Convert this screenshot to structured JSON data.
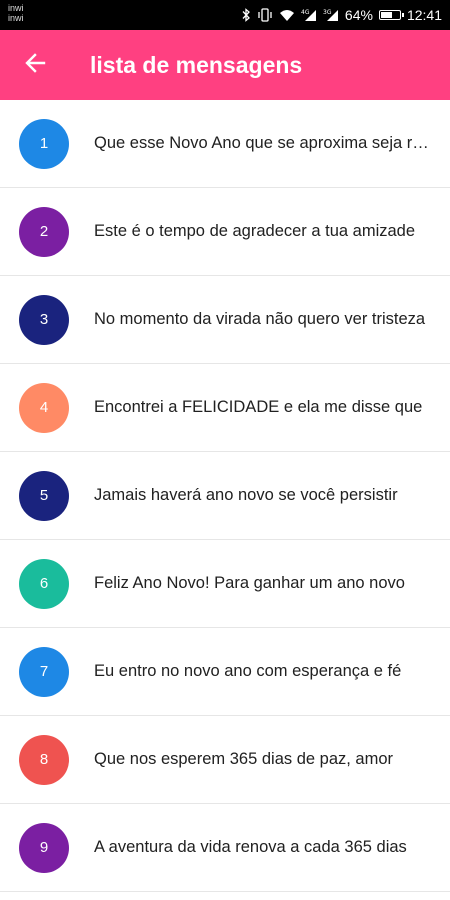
{
  "status_bar": {
    "carrier_line1": "inwi",
    "carrier_line2": "inwi",
    "battery_percent": "64%",
    "battery_level": 0.64,
    "time": "12:41",
    "icons": [
      "bluetooth-icon",
      "vibrate-icon",
      "wifi-icon",
      "signal-4g-icon",
      "signal-3g-icon",
      "battery-icon"
    ]
  },
  "app_bar": {
    "title": "lista de mensagens",
    "back_icon": "arrow-back-icon",
    "background": "#ff4081"
  },
  "messages": [
    {
      "number": "1",
      "text": "Que esse Novo Ano que se aproxima seja repleto de paz",
      "color": "#1e88e5"
    },
    {
      "number": "2",
      "text": "Este é o tempo de agradecer a tua amizade",
      "color": "#7b1fa2"
    },
    {
      "number": "3",
      "text": "No momento da virada não quero ver tristeza",
      "color": "#1a237e"
    },
    {
      "number": "4",
      "text": "Encontrei a FELICIDADE e ela me disse que",
      "color": "#ff8a65"
    },
    {
      "number": "5",
      "text": "Jamais haverá ano novo se você persistir",
      "color": "#1a237e"
    },
    {
      "number": "6",
      "text": "Feliz Ano Novo! Para ganhar um ano novo",
      "color": "#1abc9c"
    },
    {
      "number": "7",
      "text": "Eu entro no novo ano com esperança e fé",
      "color": "#1e88e5"
    },
    {
      "number": "8",
      "text": "Que nos esperem 365 dias de paz, amor",
      "color": "#ef5350"
    },
    {
      "number": "9",
      "text": "A aventura da vida renova a cada 365 dias",
      "color": "#7b1fa2"
    }
  ]
}
